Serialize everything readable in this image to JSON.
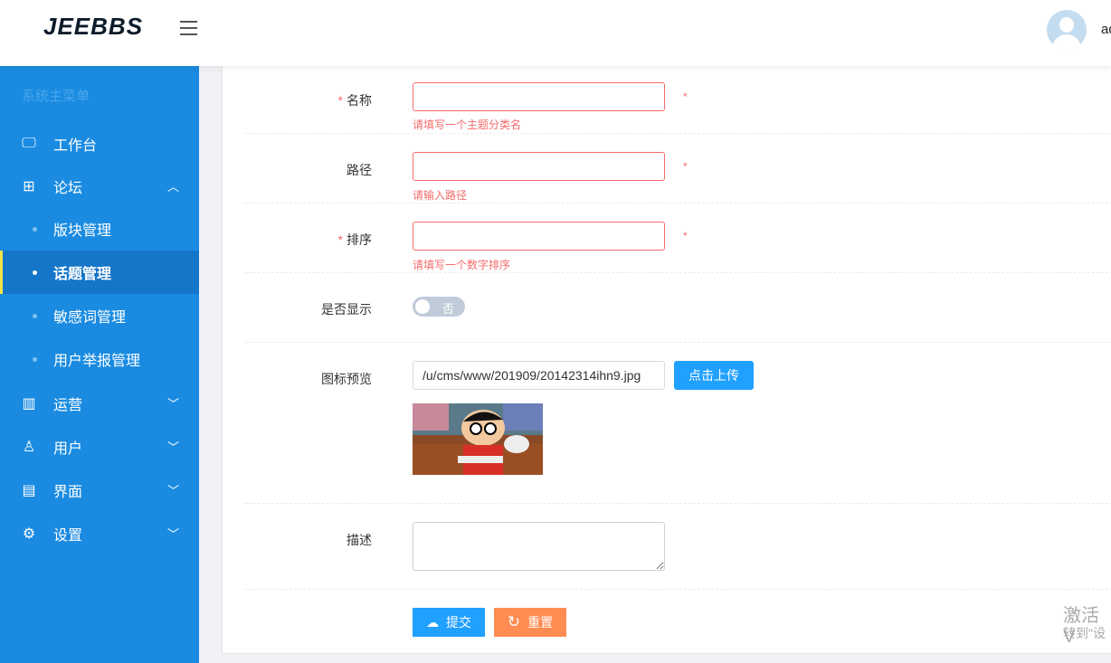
{
  "header": {
    "logo": "JEEBBS",
    "username": "ad"
  },
  "sidebar": {
    "title": "系统主菜单",
    "items": [
      {
        "label": "工作台",
        "icon": "monitor-icon"
      },
      {
        "label": "论坛",
        "icon": "grid-icon",
        "expanded": true
      },
      {
        "label": "版块管理"
      },
      {
        "label": "话题管理",
        "active": true
      },
      {
        "label": "敏感词管理"
      },
      {
        "label": "用户举报管理"
      },
      {
        "label": "运营",
        "icon": "bar-chart-icon"
      },
      {
        "label": "用户",
        "icon": "user-icon"
      },
      {
        "label": "界面",
        "icon": "layout-icon"
      },
      {
        "label": "设置",
        "icon": "gear-icon"
      }
    ]
  },
  "form": {
    "name": {
      "label": "名称",
      "value": "",
      "error": "请填写一个主题分类名",
      "star": "*"
    },
    "path": {
      "label": "路径",
      "value": "",
      "error": "请输入路径",
      "star": "*"
    },
    "order": {
      "label": "排序",
      "value": "",
      "error": "请填写一个数字排序",
      "star": "*"
    },
    "show": {
      "label": "是否显示",
      "state": "否"
    },
    "icon": {
      "label": "图标预览",
      "value": "/u/cms/www/201909/20142314ihn9.jpg",
      "upload": "点击上传"
    },
    "desc": {
      "label": "描述",
      "value": ""
    },
    "submit": "提交",
    "reset": "重置",
    "req": "*"
  },
  "watermark": {
    "line1": "激活 V",
    "line2": "转到\"设"
  },
  "colors": {
    "sidebar": "#1a8be1",
    "primary": "#20a0ff",
    "reset": "#ff8c52",
    "error": "#f56c6c"
  }
}
